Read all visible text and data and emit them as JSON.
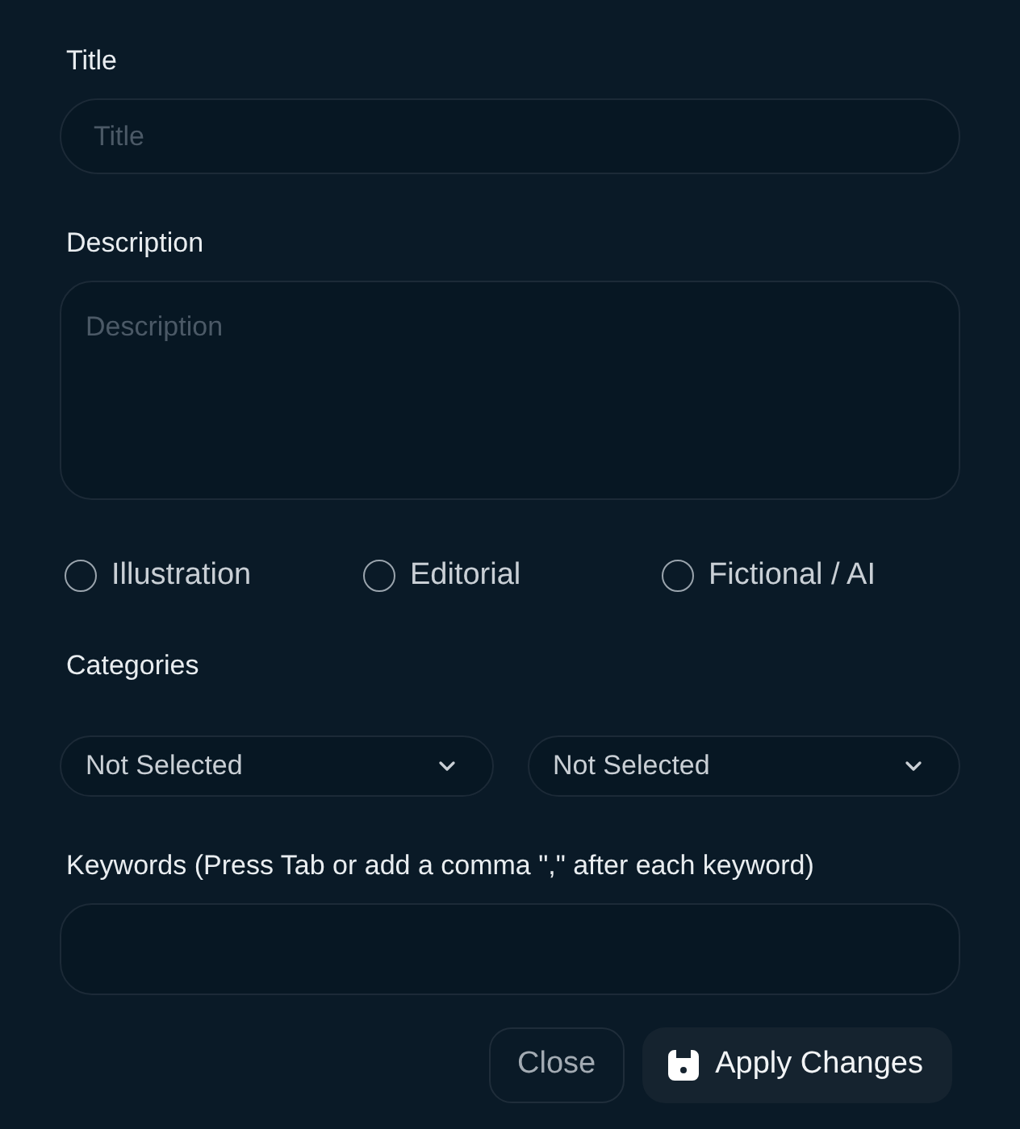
{
  "title_field": {
    "label": "Title",
    "placeholder": "Title"
  },
  "description_field": {
    "label": "Description",
    "placeholder": "Description"
  },
  "content_types": [
    {
      "label": "Illustration",
      "selected": false
    },
    {
      "label": "Editorial",
      "selected": false
    },
    {
      "label": "Fictional / AI",
      "selected": false
    }
  ],
  "categories": {
    "label": "Categories",
    "selects": [
      {
        "value": "Not Selected"
      },
      {
        "value": "Not Selected"
      }
    ]
  },
  "keywords_field": {
    "label": "Keywords (Press Tab or add a comma \",\" after each keyword)"
  },
  "buttons": [
    {
      "kind": "secondary",
      "label": "Close"
    },
    {
      "kind": "primary",
      "label": "Apply Changes"
    }
  ]
}
